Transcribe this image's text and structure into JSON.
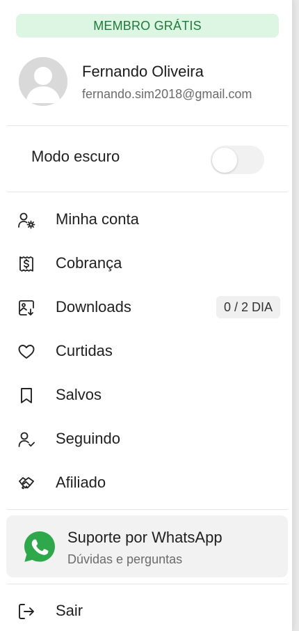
{
  "badge": {
    "label": "MEMBRO GRÁTIS"
  },
  "profile": {
    "name": "Fernando Oliveira",
    "email": "fernando.sim2018@gmail.com"
  },
  "dark_mode": {
    "label": "Modo escuro",
    "enabled": false
  },
  "menu": {
    "items": [
      {
        "label": "Minha conta",
        "icon": "user-gear-icon"
      },
      {
        "label": "Cobrança",
        "icon": "receipt-dollar-icon"
      },
      {
        "label": "Downloads",
        "icon": "image-download-icon",
        "quota": "0 / 2 DIA"
      },
      {
        "label": "Curtidas",
        "icon": "heart-icon"
      },
      {
        "label": "Salvos",
        "icon": "bookmark-icon"
      },
      {
        "label": "Seguindo",
        "icon": "user-check-icon"
      },
      {
        "label": "Afiliado",
        "icon": "handshake-icon"
      }
    ]
  },
  "support": {
    "title": "Suporte por WhatsApp",
    "subtitle": "Dúvidas e perguntas",
    "icon": "whatsapp-icon",
    "color": "#2ea84a"
  },
  "logout": {
    "label": "Sair",
    "icon": "logout-icon"
  },
  "colors": {
    "badge_bg": "#dcf6e3",
    "badge_text": "#1f7a3a"
  }
}
